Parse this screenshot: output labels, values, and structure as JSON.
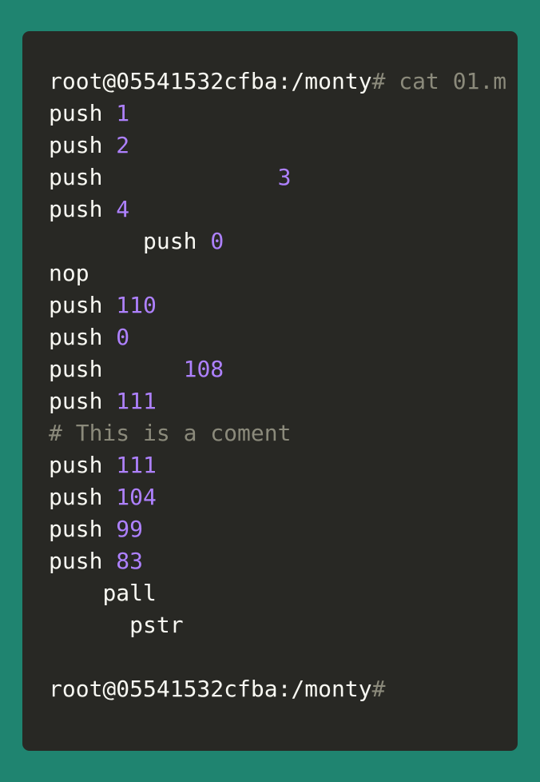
{
  "terminal": {
    "prompt": "root@05541532cfba:/monty",
    "prompt_symbol": "#",
    "command": " cat 01.m",
    "lines": [
      {
        "indent": "",
        "kw": "push",
        "gap": " ",
        "num": "1"
      },
      {
        "indent": "",
        "kw": "push",
        "gap": " ",
        "num": "2"
      },
      {
        "indent": "",
        "kw": "push",
        "gap": "             ",
        "num": "3"
      },
      {
        "indent": "",
        "kw": "push",
        "gap": " ",
        "num": "4"
      },
      {
        "indent": "       ",
        "kw": "push",
        "gap": " ",
        "num": "0"
      },
      {
        "indent": "",
        "kw": "nop",
        "gap": "",
        "num": ""
      },
      {
        "indent": "",
        "kw": "push",
        "gap": " ",
        "num": "110"
      },
      {
        "indent": "",
        "kw": "push",
        "gap": " ",
        "num": "0"
      },
      {
        "indent": "",
        "kw": "push",
        "gap": "      ",
        "num": "108"
      },
      {
        "indent": "",
        "kw": "push",
        "gap": " ",
        "num": "111"
      },
      {
        "comment": "# This is a coment"
      },
      {
        "indent": "",
        "kw": "push",
        "gap": " ",
        "num": "111"
      },
      {
        "indent": "",
        "kw": "push",
        "gap": " ",
        "num": "104"
      },
      {
        "indent": "",
        "kw": "push",
        "gap": " ",
        "num": "99"
      },
      {
        "indent": "",
        "kw": "push",
        "gap": " ",
        "num": "83"
      },
      {
        "indent": "    ",
        "kw": "pall",
        "gap": "",
        "num": ""
      },
      {
        "indent": "      ",
        "kw": "pstr",
        "gap": "",
        "num": ""
      },
      {
        "blank": true
      }
    ],
    "final_prompt": "root@05541532cfba:/monty",
    "final_symbol": "#"
  },
  "colors": {
    "background": "#1f8470",
    "terminal_bg": "#282824",
    "text": "#f8f8f2",
    "number": "#ae81ff",
    "comment": "#8b8a7b"
  }
}
